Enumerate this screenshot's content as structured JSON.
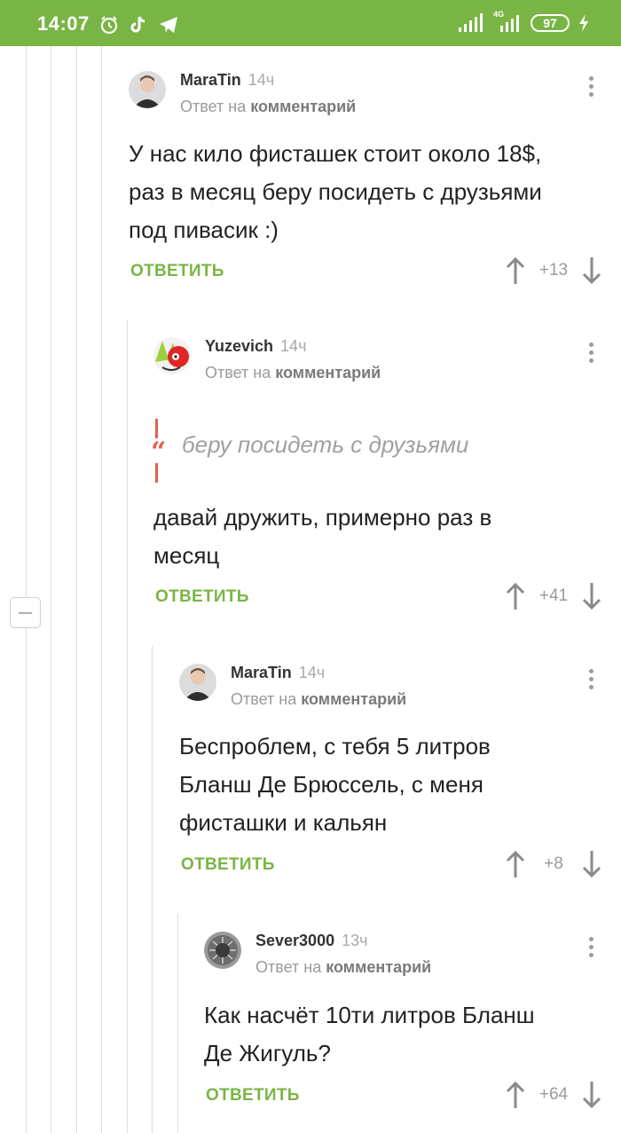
{
  "status_bar": {
    "time": "14:07",
    "network": "4G",
    "battery": "97"
  },
  "comments": [
    {
      "author": "MaraTin",
      "time": "14ч",
      "reply_prefix": "Ответ на",
      "reply_target": "комментарий",
      "lines": [
        "У нас кило фисташек стоит около 18$,",
        "раз в месяц беру посидеть с друзьями",
        "под пивасик :)"
      ],
      "reply_label": "ОТВЕТИТЬ",
      "score": "+13"
    },
    {
      "author": "Yuzevich",
      "time": "14ч",
      "reply_prefix": "Ответ на",
      "reply_target": "комментарий",
      "quote": "беру посидеть с друзьями",
      "lines": [
        "давай дружить, примерно раз в",
        "месяц"
      ],
      "reply_label": "ОТВЕТИТЬ",
      "score": "+41"
    },
    {
      "author": "MaraTin",
      "time": "14ч",
      "reply_prefix": "Ответ на",
      "reply_target": "комментарий",
      "lines": [
        "Беспроблем, с тебя 5 литров",
        "Бланш Де Брюссель, с меня",
        "фисташки и кальян"
      ],
      "reply_label": "ОТВЕТИТЬ",
      "score": "+8"
    },
    {
      "author": "Sever3000",
      "time": "13ч",
      "reply_prefix": "Ответ на",
      "reply_target": "комментарий",
      "lines": [
        "Как насчёт 10ти литров Бланш",
        "Де Жигуль?"
      ],
      "reply_label": "ОТВЕТИТЬ",
      "score": "+64"
    }
  ]
}
